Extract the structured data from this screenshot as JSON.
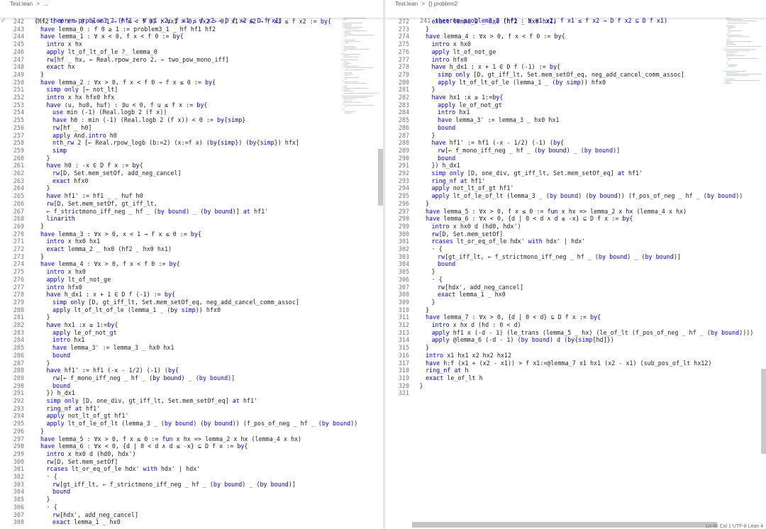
{
  "left_pane": {
    "breadcrumb": [
      "Test.lean",
      ">",
      "..."
    ],
    "sticky": {
      "num": "241",
      "text": "theorem problem3_2 (hf1 : ∀ x1 x2, f x1 ≤ f x2 → D f x2 ⊆ D f x1)"
    },
    "lines": [
      {
        "n": "242",
        "i": 1,
        "t": "(hf2 : ∀ x > 0, x < 1 → f x < f 0) : ∀x1 > 0, ∀x2 > 0, x1 < x2 → f x1 ≤ f x2 := by{"
      },
      {
        "n": "243",
        "i": 2,
        "t": "have lemma_0 : f 0 ≥ 1 := problem3_1 _ hf hf1 hf2"
      },
      {
        "n": "244",
        "i": 2,
        "t": "have lemma_1 : ∀ x < 0, f x < f 0 := by{"
      },
      {
        "n": "245",
        "i": 3,
        "t": "intro x hx"
      },
      {
        "n": "246",
        "i": 3,
        "t": "apply lt_of_lt_of_le ?_ lemma_0"
      },
      {
        "n": "247",
        "i": 3,
        "t": "rw[hf _ hx, ← Real.rpow_zero 2, ← two_pow_mono_iff]"
      },
      {
        "n": "248",
        "i": 3,
        "t": "exact hx"
      },
      {
        "n": "249",
        "i": 2,
        "t": "}"
      },
      {
        "n": "250",
        "i": 2,
        "t": "have lemma_2 : ∀x > 0, f x < f 0 → f x ≤ 0 := by{"
      },
      {
        "n": "251",
        "i": 3,
        "t": "simp only [← not_lt]"
      },
      {
        "n": "252",
        "i": 3,
        "t": "intro x hx hfx0 hfx"
      },
      {
        "n": "253",
        "i": 3,
        "t": "have ⟨u, hu0, huf⟩ : ∃u < 0, f u ≤ f x := by{"
      },
      {
        "n": "254",
        "i": 4,
        "t": "use min (-1) (Real.logb 2 (f x))"
      },
      {
        "n": "255",
        "i": 4,
        "t": "have h0 : min (-1) (Real.logb 2 (f x)) < 0 := by{simp}"
      },
      {
        "n": "256",
        "i": 4,
        "t": "rw[hf _ h0]"
      },
      {
        "n": "257",
        "i": 4,
        "t": "apply And.intro h0"
      },
      {
        "n": "258",
        "i": 4,
        "t": "nth_rw 2 [← Real.rpow_logb (b:=2) (x:=f x) (by{simp}) (by{simp}) hfx]"
      },
      {
        "n": "259",
        "i": 4,
        "t": "simp"
      },
      {
        "n": "260",
        "i": 3,
        "t": "}"
      },
      {
        "n": "261",
        "i": 3,
        "t": "have h0 : -x ∈ D f x := by{"
      },
      {
        "n": "262",
        "i": 4,
        "t": "rw[D, Set.mem_setOf, add_neg_cancel]"
      },
      {
        "n": "263",
        "i": 4,
        "t": "exact hfx0"
      },
      {
        "n": "264",
        "i": 3,
        "t": "}"
      },
      {
        "n": "265",
        "i": 3,
        "t": "have hf1' := hf1 _ _ huf h0"
      },
      {
        "n": "266",
        "i": 3,
        "t": "rw[D, Set.mem_setOf, gt_iff_lt,"
      },
      {
        "n": "267",
        "i": 3,
        "t": "← f_strictmono_iff_neg _ hf _ (by bound) _ (by bound)] at hf1'"
      },
      {
        "n": "268",
        "i": 3,
        "t": "linarith"
      },
      {
        "n": "269",
        "i": 2,
        "t": "}"
      },
      {
        "n": "270",
        "i": 2,
        "t": "have lemma_3 : ∀x > 0, x < 1 → f x ≤ 0 := by{"
      },
      {
        "n": "271",
        "i": 3,
        "t": "intro x hx0 hx1"
      },
      {
        "n": "272",
        "i": 3,
        "t": "exact lemma_2 _ hx0 (hf2 _ hx0 hx1)"
      },
      {
        "n": "273",
        "i": 2,
        "t": "}"
      },
      {
        "n": "274",
        "i": 2,
        "t": "have lemma_4 : ∀x > 0, f x < f 0 := by{"
      },
      {
        "n": "275",
        "i": 3,
        "t": "intro x hx0"
      },
      {
        "n": "276",
        "i": 3,
        "t": "apply lt_of_not_ge"
      },
      {
        "n": "277",
        "i": 3,
        "t": "intro hfx0"
      },
      {
        "n": "278",
        "i": 3,
        "t": "have h_dx1 : x + 1 ∈ D f (-1) := by{"
      },
      {
        "n": "279",
        "i": 4,
        "t": "simp only [D, gt_iff_lt, Set.mem_setOf_eq, neg_add_cancel_comm_assoc]"
      },
      {
        "n": "280",
        "i": 4,
        "t": "apply lt_of_lt_of_le (lemma_1 _ (by simp)) hfx0"
      },
      {
        "n": "281",
        "i": 3,
        "t": "}"
      },
      {
        "n": "282",
        "i": 3,
        "t": "have hx1 :x ≥ 1:=by{"
      },
      {
        "n": "283",
        "i": 4,
        "t": "apply le_of_not_gt"
      },
      {
        "n": "284",
        "i": 4,
        "t": "intro hx1"
      },
      {
        "n": "285",
        "i": 4,
        "t": "have lemma_3' := lemma_3 _ hx0 hx1"
      },
      {
        "n": "286",
        "i": 4,
        "t": "bound"
      },
      {
        "n": "287",
        "i": 3,
        "t": "}"
      },
      {
        "n": "288",
        "i": 3,
        "t": "have hf1' := hf1 (-x - 1/2) (-1) (by{"
      },
      {
        "n": "289",
        "i": 4,
        "t": "rw[← f_mono_iff_neg _ hf _ (by bound) _ (by bound)]"
      },
      {
        "n": "290",
        "i": 4,
        "t": "bound"
      },
      {
        "n": "291",
        "i": 3,
        "t": "}) h_dx1"
      },
      {
        "n": "292",
        "i": 3,
        "t": "simp only [D, one_div, gt_iff_lt, Set.mem_setOf_eq] at hf1'"
      },
      {
        "n": "293",
        "i": 3,
        "t": "ring_nf at hf1'"
      },
      {
        "n": "294",
        "i": 3,
        "t": "apply not_lt_of_gt hf1'"
      },
      {
        "n": "295",
        "i": 3,
        "t": "apply lt_of_le_of_lt (lemma_3 _ (by bound) (by bound)) (f_pos_of_neg _ hf _ (by bound))"
      },
      {
        "n": "296",
        "i": 2,
        "t": "}"
      },
      {
        "n": "297",
        "i": 2,
        "t": "have lemma_5 : ∀x > 0, f x ≤ 0 := fun x hx => lemma_2 x hx (lemma_4 x hx)"
      },
      {
        "n": "298",
        "i": 2,
        "t": "have lemma_6 : ∀x < 0, {d | 0 < d ∧ d ≤ -x} ⊆ D f x := by{"
      },
      {
        "n": "299",
        "i": 3,
        "t": "intro x hx0 d (hd0, hdx')"
      },
      {
        "n": "300",
        "i": 3,
        "t": "rw[D, Set.mem_setOf]"
      },
      {
        "n": "301",
        "i": 3,
        "t": "rcases lt_or_eq_of_le hdx' with hdx' | hdx'"
      },
      {
        "n": "302",
        "i": 3,
        "t": "· {"
      },
      {
        "n": "303",
        "i": 4,
        "t": "rw[gt_iff_lt, ← f_strictmono_iff_neg _ hf _ (by bound) _ (by bound)]"
      },
      {
        "n": "304",
        "i": 4,
        "t": "bound"
      },
      {
        "n": "305",
        "i": 3,
        "t": "}"
      },
      {
        "n": "306",
        "i": 3,
        "t": "· {"
      },
      {
        "n": "307",
        "i": 4,
        "t": "rw[hdx', add_neg_cancel]"
      },
      {
        "n": "308",
        "i": 4,
        "t": "exact lemma_1 _ hx0"
      }
    ]
  },
  "right_pane": {
    "breadcrumb": [
      "Test.lean",
      ">",
      "{} problem2"
    ],
    "sticky": {
      "num": "241",
      "text": "theorem problem3_2 (hf1 : ∀ x1 x2, f x1 ≤ f x2 → D f x2 ⊆ D f x1)"
    },
    "lines": [
      {
        "n": "272",
        "i": 3,
        "t": "exact lemma_2 _ hx0 (hf2 _ hx0 hx1)"
      },
      {
        "n": "273",
        "i": 2,
        "t": "}"
      },
      {
        "n": "274",
        "i": 2,
        "t": "have lemma_4 : ∀x > 0, f x < f 0 := by{"
      },
      {
        "n": "275",
        "i": 3,
        "t": "intro x hx0"
      },
      {
        "n": "276",
        "i": 3,
        "t": "apply lt_of_not_ge"
      },
      {
        "n": "277",
        "i": 3,
        "t": "intro hfx0"
      },
      {
        "n": "278",
        "i": 3,
        "t": "have h_dx1 : x + 1 ∈ D f (-1) := by{"
      },
      {
        "n": "279",
        "i": 4,
        "t": "simp only [D, gt_iff_lt, Set.mem_setOf_eq, neg_add_cancel_comm_assoc]"
      },
      {
        "n": "280",
        "i": 4,
        "t": "apply lt_of_lt_of_le (lemma_1 _ (by simp)) hfx0"
      },
      {
        "n": "281",
        "i": 3,
        "t": "}"
      },
      {
        "n": "282",
        "i": 3,
        "t": "have hx1 :x ≥ 1:=by{"
      },
      {
        "n": "283",
        "i": 4,
        "t": "apply le_of_not_gt"
      },
      {
        "n": "284",
        "i": 4,
        "t": "intro hx1"
      },
      {
        "n": "285",
        "i": 4,
        "t": "have lemma_3' := lemma_3 _ hx0 hx1"
      },
      {
        "n": "286",
        "i": 4,
        "t": "bound"
      },
      {
        "n": "287",
        "i": 3,
        "t": "}"
      },
      {
        "n": "288",
        "i": 3,
        "t": "have hf1' := hf1 (-x - 1/2) (-1) (by{"
      },
      {
        "n": "289",
        "i": 4,
        "t": "rw[← f_mono_iff_neg _ hf _ (by bound) _ (by bound)]"
      },
      {
        "n": "290",
        "i": 4,
        "t": "bound"
      },
      {
        "n": "291",
        "i": 3,
        "t": "}) h_dx1"
      },
      {
        "n": "292",
        "i": 3,
        "t": "simp only [D, one_div, gt_iff_lt, Set.mem_setOf_eq] at hf1'"
      },
      {
        "n": "293",
        "i": 3,
        "t": "ring_nf at hf1'"
      },
      {
        "n": "294",
        "i": 3,
        "t": "apply not_lt_of_gt hf1'"
      },
      {
        "n": "295",
        "i": 3,
        "t": "apply lt_of_le_of_lt (lemma_3 _ (by bound) (by bound)) (f_pos_of_neg _ hf _ (by bound))"
      },
      {
        "n": "296",
        "i": 2,
        "t": "}"
      },
      {
        "n": "297",
        "i": 2,
        "t": "have lemma_5 : ∀x > 0, f x ≤ 0 := fun x hx => lemma_2 x hx (lemma_4 x hx)"
      },
      {
        "n": "298",
        "i": 2,
        "t": "have lemma_6 : ∀x < 0, {d | 0 < d ∧ d ≤ -x} ⊆ D f x := by{"
      },
      {
        "n": "299",
        "i": 3,
        "t": "intro x hx0 d (hd0, hdx')"
      },
      {
        "n": "300",
        "i": 3,
        "t": "rw[D, Set.mem_setOf]"
      },
      {
        "n": "301",
        "i": 3,
        "t": "rcases lt_or_eq_of_le hdx' with hdx' | hdx'"
      },
      {
        "n": "302",
        "i": 3,
        "t": "· {"
      },
      {
        "n": "303",
        "i": 4,
        "t": "rw[gt_iff_lt, ← f_strictmono_iff_neg _ hf _ (by bound) _ (by bound)]"
      },
      {
        "n": "304",
        "i": 4,
        "t": "bound"
      },
      {
        "n": "305",
        "i": 3,
        "t": "}"
      },
      {
        "n": "306",
        "i": 3,
        "t": "· {"
      },
      {
        "n": "307",
        "i": 4,
        "t": "rw[hdx', add_neg_cancel]"
      },
      {
        "n": "308",
        "i": 4,
        "t": "exact lemma_1 _ hx0"
      },
      {
        "n": "309",
        "i": 3,
        "t": "}"
      },
      {
        "n": "310",
        "i": 2,
        "t": "}"
      },
      {
        "n": "311",
        "i": 2,
        "t": "have lemma_7 : ∀x > 0, {d | 0 < d} ⊆ D f x := by{"
      },
      {
        "n": "312",
        "i": 3,
        "t": "intro x hx d (hd : 0 < d)"
      },
      {
        "n": "313",
        "i": 3,
        "t": "apply hf1 x (-d - 1) (le_trans (lemma_5 _ hx) (le_of_lt (f_pos_of_neg _ hf _ (by bound))))"
      },
      {
        "n": "314",
        "i": 3,
        "t": "apply @lemma_6 (-d - 1) (by bound) d (by{simp[hd]})"
      },
      {
        "n": "315",
        "i": 2,
        "t": "}"
      },
      {
        "n": "316",
        "i": 2,
        "t": "intro x1 hx1 x2 hx2 hx12"
      },
      {
        "n": "317",
        "i": 2,
        "t": "have h:f (x1 + (x2 - x1)) > f x1:=@lemma_7 x1 hx1 (x2 - x1) (sub_pos_of_lt hx12)"
      },
      {
        "n": "318",
        "i": 2,
        "t": "ring_nf at h"
      },
      {
        "n": "319",
        "i": 2,
        "t": "exact le_of_lt h"
      },
      {
        "n": "320",
        "i": 1,
        "t": "}"
      },
      {
        "n": "321",
        "i": 0,
        "t": ""
      }
    ]
  },
  "status_bar": {
    "text": "Ln 40  Col 1  UTF-8  Lean 4"
  }
}
